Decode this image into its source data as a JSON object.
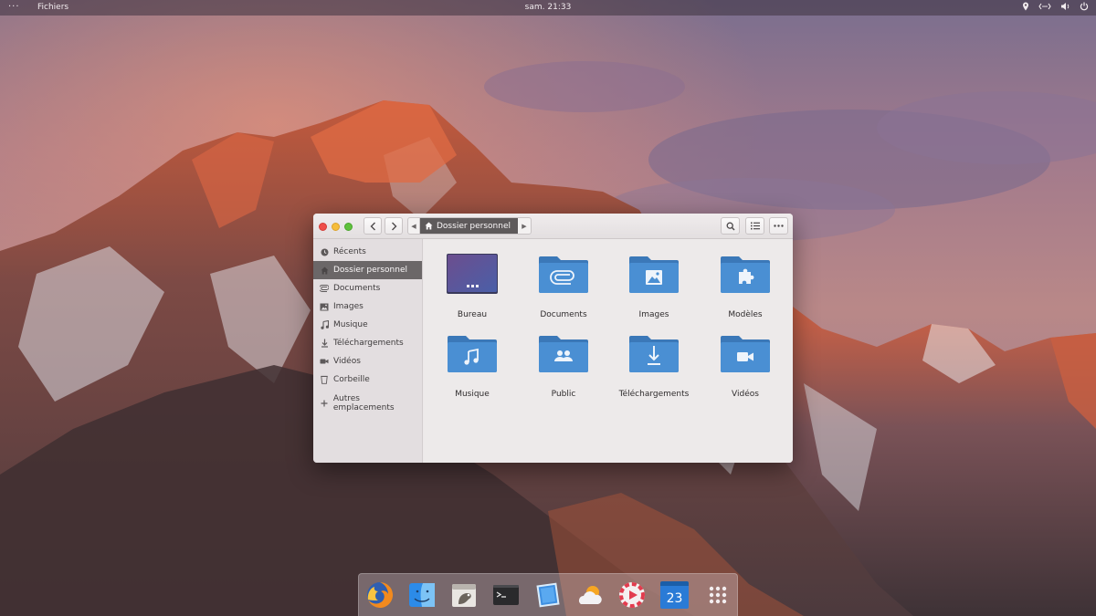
{
  "top_panel": {
    "menu_dots": "···",
    "app_name": "Fichiers",
    "clock": "sam. 21:33",
    "tray_icons": [
      "location-icon",
      "network-icon",
      "volume-icon",
      "power-icon"
    ]
  },
  "window": {
    "path": "Dossier personnel",
    "sidebar": {
      "items": [
        {
          "label": "Récents",
          "icon": "clock-icon",
          "active": false
        },
        {
          "label": "Dossier personnel",
          "icon": "home-icon",
          "active": true
        },
        {
          "label": "Documents",
          "icon": "paperclip-icon",
          "active": false
        },
        {
          "label": "Images",
          "icon": "image-icon",
          "active": false
        },
        {
          "label": "Musique",
          "icon": "music-note-icon",
          "active": false
        },
        {
          "label": "Téléchargements",
          "icon": "download-icon",
          "active": false
        },
        {
          "label": "Vidéos",
          "icon": "video-camera-icon",
          "active": false
        },
        {
          "label": "Corbeille",
          "icon": "trash-icon",
          "active": false
        }
      ],
      "other_locations": "Autres emplacements"
    },
    "folders": [
      {
        "label": "Bureau",
        "icon": "desktop-folder-icon"
      },
      {
        "label": "Documents",
        "icon": "documents-folder-icon"
      },
      {
        "label": "Images",
        "icon": "pictures-folder-icon"
      },
      {
        "label": "Modèles",
        "icon": "templates-folder-icon"
      },
      {
        "label": "Musique",
        "icon": "music-folder-icon"
      },
      {
        "label": "Public",
        "icon": "public-folder-icon"
      },
      {
        "label": "Téléchargements",
        "icon": "downloads-folder-icon"
      },
      {
        "label": "Vidéos",
        "icon": "videos-folder-icon"
      }
    ]
  },
  "dock": {
    "calendar_day": "23",
    "apps": [
      "firefox-icon",
      "finder-icon",
      "gimp-icon",
      "terminal-icon",
      "text-editor-icon",
      "weather-icon",
      "media-player-icon",
      "calendar-icon",
      "app-grid-icon"
    ]
  },
  "colors": {
    "folder_blue": "#4a8fd3",
    "folder_blue_dark": "#3b78b8",
    "close_red": "#ef4e4a",
    "minimize_yellow": "#f6bd3a",
    "maximize_green": "#5fc13d"
  }
}
